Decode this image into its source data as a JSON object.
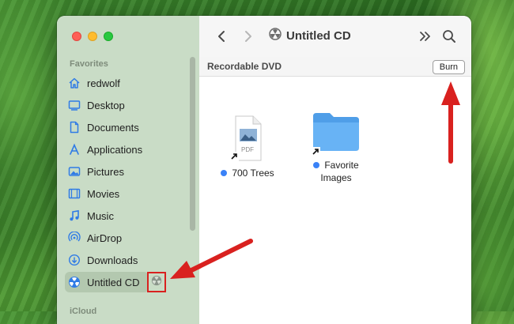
{
  "window": {
    "title": "Untitled CD",
    "burn_bar": {
      "label": "Recordable DVD",
      "burn_button": "Burn"
    }
  },
  "sidebar": {
    "section_favorites": "Favorites",
    "items": [
      {
        "label": "redwolf",
        "icon": "home-icon"
      },
      {
        "label": "Desktop",
        "icon": "desktop-icon"
      },
      {
        "label": "Documents",
        "icon": "document-icon"
      },
      {
        "label": "Applications",
        "icon": "applications-icon"
      },
      {
        "label": "Pictures",
        "icon": "pictures-icon"
      },
      {
        "label": "Movies",
        "icon": "movies-icon"
      },
      {
        "label": "Music",
        "icon": "music-icon"
      },
      {
        "label": "AirDrop",
        "icon": "airdrop-icon"
      },
      {
        "label": "Downloads",
        "icon": "downloads-icon"
      },
      {
        "label": "Untitled CD",
        "icon": "burn-disc-icon",
        "selected": true
      }
    ],
    "section_icloud": "iCloud"
  },
  "files": [
    {
      "name": "700 Trees",
      "kind": "pdf-alias",
      "tag_color": "#3a82f7",
      "badge": "PDF"
    },
    {
      "name_line1": "Favorite",
      "name_line2": "Images",
      "kind": "folder-alias",
      "tag_color": "#3a82f7"
    }
  ],
  "colors": {
    "accent": "#3a82f7",
    "annotation_arrow": "#d9211f",
    "sidebar_bg": "#c9dcc6"
  }
}
